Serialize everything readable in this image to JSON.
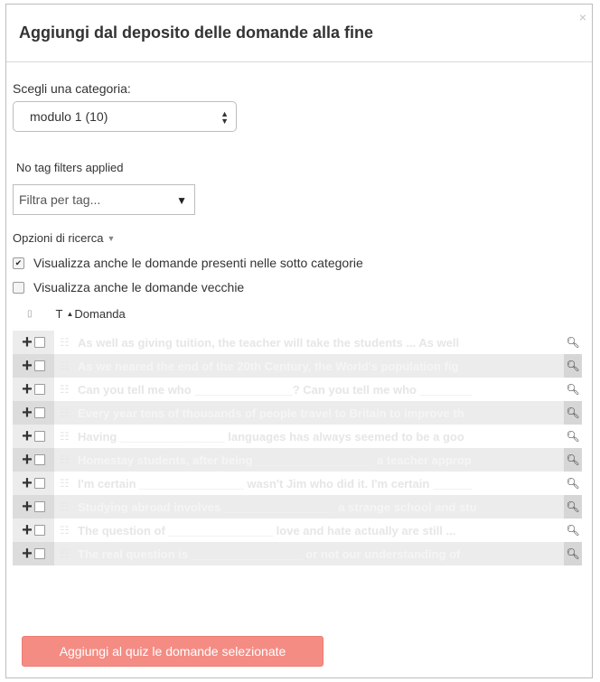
{
  "dialog": {
    "title": "Aggiungi dal deposito delle domande alla fine",
    "close_glyph": "×"
  },
  "category": {
    "label": "Scegli una categoria:",
    "selected": "modulo 1 (10)"
  },
  "tags": {
    "status": "No tag filters applied",
    "placeholder": "Filtra per tag..."
  },
  "search_options": {
    "label": "Opzioni di ricerca",
    "show_subcategories": "Visualizza anche le domande presenti nelle sotto categorie",
    "show_subcategories_checked": true,
    "show_old": "Visualizza anche le domande vecchie",
    "show_old_checked": false
  },
  "sort": {
    "type_col": "T",
    "name_col": "Domanda"
  },
  "questions": [
    "As well as giving tuition, the teacher will take the students ... As well",
    "As we neared the end of the 20th Century, the World's population fig",
    "Can you tell me who _______________? Can you tell me who ________",
    "Every year tens of thousands of people travel to Britain to improve th",
    "Having ________________ languages has always seemed to be a goo",
    "Homestay students, after being __________________ a teacher approp",
    "I'm certain ________________ wasn't Jim who did it. I'm certain ______",
    "Studying abroad involves _________________ a strange school and stu",
    "The question of ________________ love and hate actually are still ...",
    "The real question is _________________ or not our understanding of"
  ],
  "icons": {
    "add": "plus-icon",
    "preview": "magnifier-icon",
    "qtype": "essay-icon"
  },
  "actions": {
    "add_selected": "Aggiungi al quiz le domande selezionate"
  },
  "colors": {
    "primary_button": "#f48c84",
    "row_alt": "#ececec"
  }
}
